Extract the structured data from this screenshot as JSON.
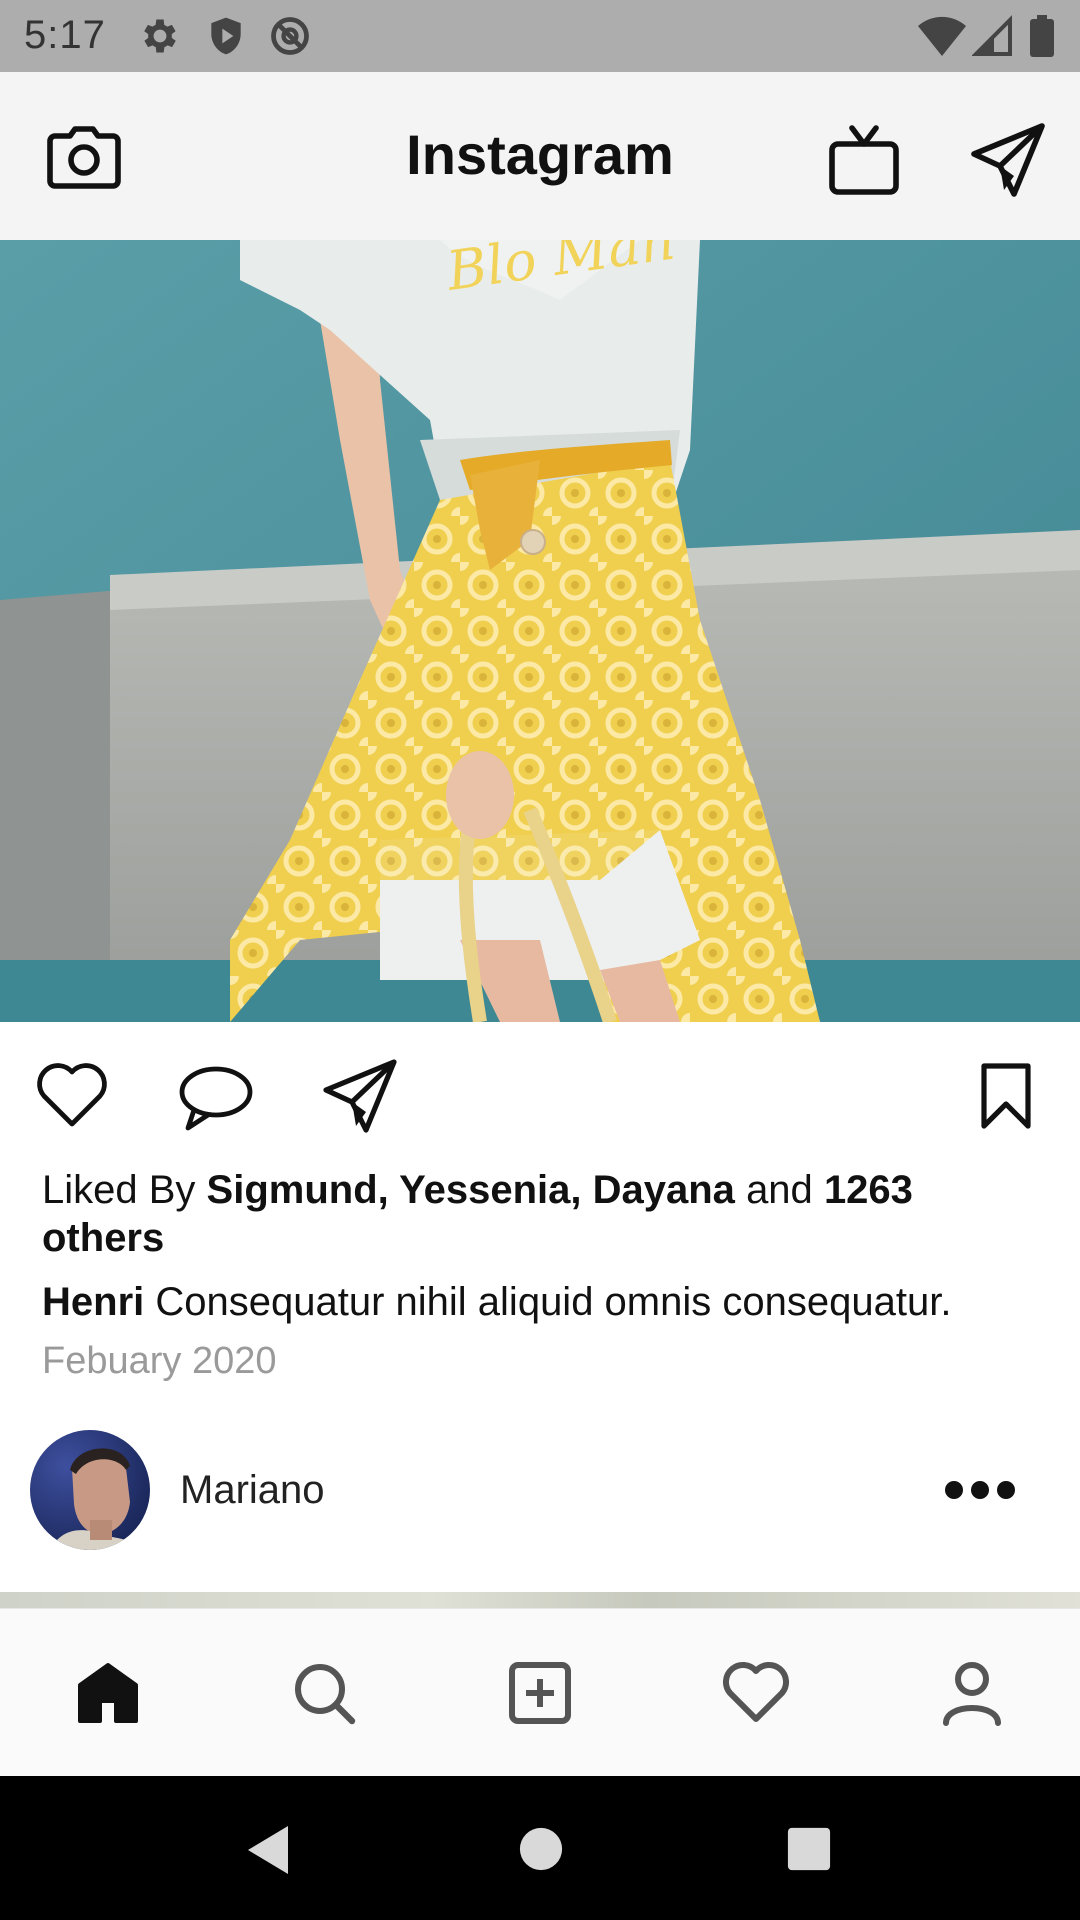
{
  "status_bar": {
    "time": "5:17"
  },
  "header": {
    "title": "Instagram"
  },
  "post": {
    "likes_prefix": "Liked By",
    "liked_by_names": "Sigmund, Yessenia, Dayana",
    "likes_and": "and",
    "likes_count_text": "1263 others",
    "caption_author": "Henri",
    "caption_text": "Consequatur nihil aliquid omnis consequatur.",
    "date": "Febuary 2020"
  },
  "next_post": {
    "username": "Mariano"
  },
  "tabs": [
    "home-icon",
    "search-icon",
    "add-post-icon",
    "heart-icon",
    "profile-icon"
  ],
  "colors": {
    "status_bar": "#adadad",
    "header_bg": "#f4f4f4",
    "tab_bar_bg": "#fafafa",
    "date_gray": "#9a9a9a"
  }
}
